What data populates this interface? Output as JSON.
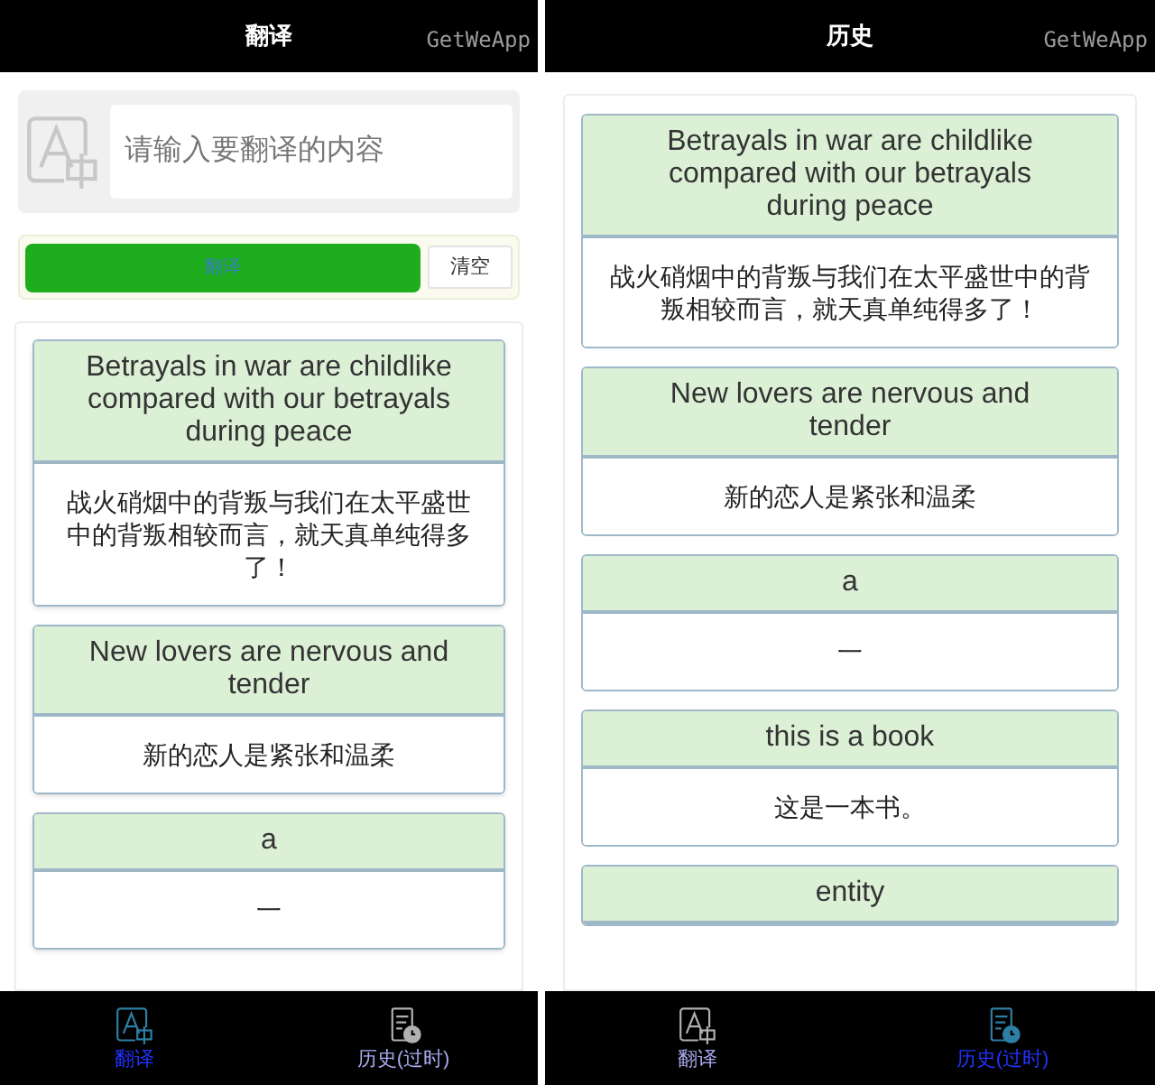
{
  "screens": [
    {
      "kind": "translate",
      "title": "翻译",
      "brand": "GetWeApp",
      "input": {
        "placeholder": "请输入要翻译的内容"
      },
      "translate_button": "翻译",
      "clear_button": "清空",
      "results": [
        {
          "source": "Betrayals in war are childlike compared with our betrayals during peace",
          "target": "战火硝烟中的背叛与我们在太平盛世中的背叛相较而言，就天真单纯得多了！"
        },
        {
          "source": "New lovers are nervous and tender",
          "target": "新的恋人是紧张和温柔"
        },
        {
          "source": "a",
          "target": "一"
        }
      ],
      "tabs": [
        {
          "label": "翻译",
          "kind": "translate",
          "selected": true
        },
        {
          "label": "历史(过时)",
          "kind": "history",
          "selected": false
        }
      ]
    },
    {
      "kind": "history",
      "title": "历史",
      "brand": "GetWeApp",
      "results": [
        {
          "source": "Betrayals in war are childlike compared with our betrayals during peace",
          "target": "战火硝烟中的背叛与我们在太平盛世中的背叛相较而言，就天真单纯得多了！"
        },
        {
          "source": "New lovers are nervous and tender",
          "target": "新的恋人是紧张和温柔"
        },
        {
          "source": "a",
          "target": "一"
        },
        {
          "source": "this is a book",
          "target": "这是一本书。"
        },
        {
          "source": "entity"
        }
      ],
      "tabs": [
        {
          "label": "翻译",
          "kind": "translate",
          "selected": false
        },
        {
          "label": "历史(过时)",
          "kind": "history",
          "selected": true
        }
      ]
    }
  ]
}
